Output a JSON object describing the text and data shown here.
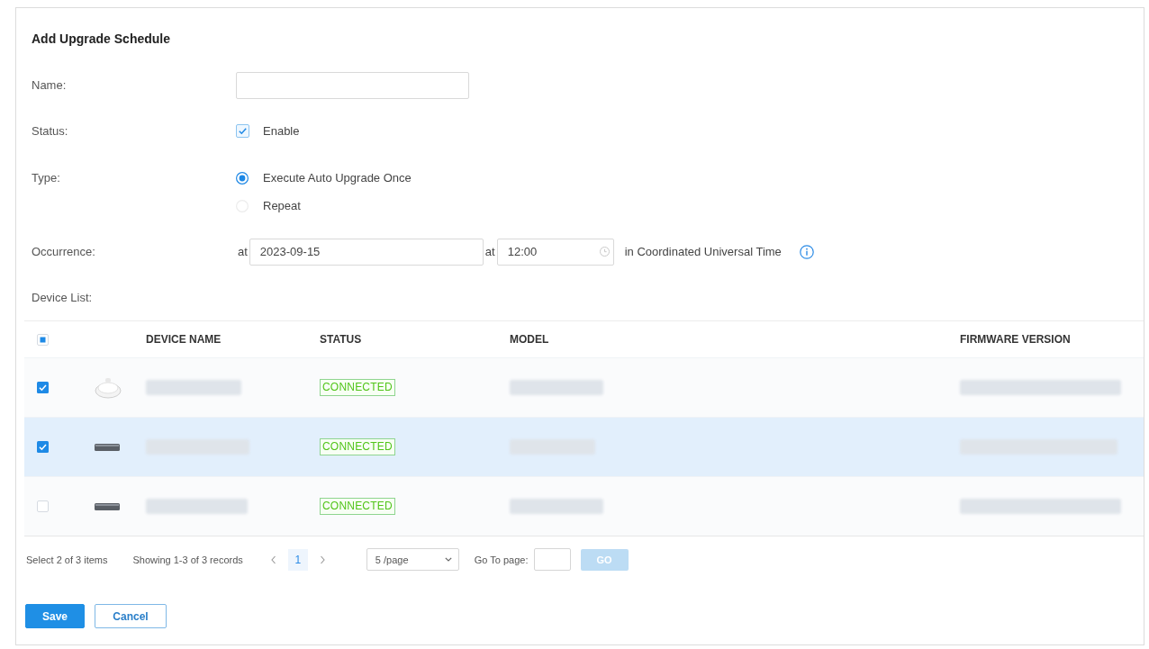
{
  "title": "Add Upgrade Schedule",
  "fields": [
    {
      "kind": "text",
      "label": "Name:"
    },
    {
      "kind": "checkbox",
      "label": "Status:",
      "option": "Enable",
      "checked": true
    },
    {
      "kind": "radio",
      "label": "Type:",
      "options": [
        {
          "label": "Execute Auto Upgrade Once",
          "selected": true
        },
        {
          "label": "Repeat",
          "selected": false
        }
      ]
    },
    {
      "kind": "datetime",
      "label": "Occurrence:",
      "date_prefix": "at",
      "date": "2023-09-15",
      "time_prefix": "at",
      "time": "12:00",
      "suffix": "in Coordinated Universal Time"
    },
    {
      "kind": "heading",
      "label": "Device List:"
    }
  ],
  "table": {
    "header_checkbox": {
      "checked": false,
      "indeterminate": true
    },
    "columns": [
      "DEVICE NAME",
      "STATUS",
      "MODEL",
      "FIRMWARE VERSION"
    ],
    "rows": [
      {
        "kind": "dome",
        "checked": true,
        "highlighted": false,
        "status": "CONNECTED"
      },
      {
        "kind": "flat",
        "checked": true,
        "highlighted": true,
        "status": "CONNECTED"
      },
      {
        "kind": "flat",
        "checked": false,
        "highlighted": false,
        "status": "CONNECTED"
      }
    ]
  },
  "pagination": {
    "selection": "Select 2 of 3 items",
    "summary": "Showing 1-3 of 3 records",
    "pages": [
      {
        "label": "1",
        "selected": true
      }
    ],
    "page_size": "5 /page",
    "goto_label": "Go To page:",
    "go_button": {
      "label": "GO",
      "disabled": true
    }
  },
  "buttons": [
    {
      "label": "Save",
      "kind": "primary"
    },
    {
      "label": "Cancel",
      "kind": "secondary"
    }
  ]
}
